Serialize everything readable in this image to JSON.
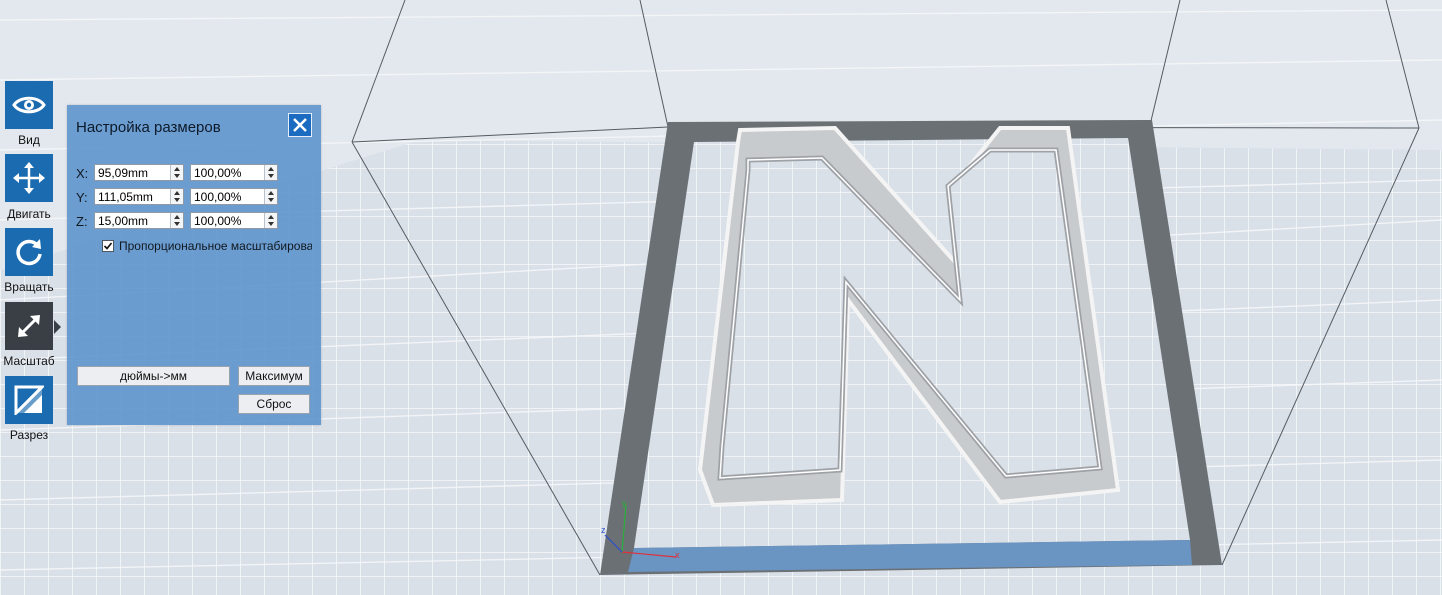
{
  "toolbar": {
    "view_label": "Вид",
    "move_label": "Двигать",
    "rotate_label": "Вращать",
    "scale_label": "Масштаб",
    "cut_label": "Разрез"
  },
  "scale_panel": {
    "title": "Настройка размеров",
    "rows": [
      {
        "axis": "X:",
        "size": "95,09mm",
        "percent": "100,00%"
      },
      {
        "axis": "Y:",
        "size": "111,05mm",
        "percent": "100,00%"
      },
      {
        "axis": "Z:",
        "size": "15,00mm",
        "percent": "100,00%"
      }
    ],
    "proportional_label": "Пропорциональное масштабирова",
    "proportional_checked": true,
    "inches_to_mm_label": "дюймы->мм",
    "max_label": "Максимум",
    "reset_label": "Сброс"
  },
  "axes": {
    "x": "x",
    "y": "y",
    "z": "z"
  },
  "colors": {
    "accent": "#1a6bb0",
    "active_tool": "#3a3f45",
    "panel": "#6297cd",
    "bed_border": "#6b7075",
    "bed_highlight": "#6a9ad0"
  }
}
